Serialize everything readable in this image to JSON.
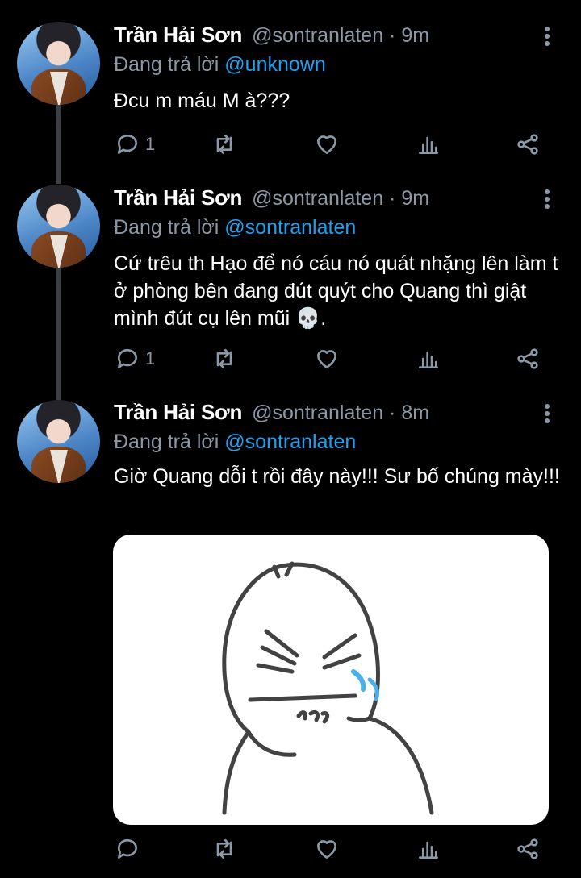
{
  "tweets": [
    {
      "name": "Trần Hải Sơn",
      "handle_time": "@sontranlaten · 9m",
      "reply_prefix": "Đang trả lời",
      "reply_to": "@unknown",
      "text": "Đcu m máu M à???",
      "reply_count": "1"
    },
    {
      "name": "Trần Hải Sơn",
      "handle_time": "@sontranlaten · 9m",
      "reply_prefix": "Đang trả lời",
      "reply_to": "@sontranlaten",
      "text": "Cứ trêu th Hạo để nó cáu nó quát nhặng lên làm t ở phòng bên đang đút quýt cho Quang thì giật mình đút cụ lên mũi 💀.",
      "reply_count": "1"
    },
    {
      "name": "Trần Hải Sơn",
      "handle_time": "@sontranlaten · 8m",
      "reply_prefix": "Đang trả lời",
      "reply_to": "@sontranlaten",
      "text": "Giờ Quang dỗi t rồi đây này!!! Sư bố chúng mày!!!",
      "reply_count": ""
    }
  ],
  "colors": {
    "background": "#000000",
    "secondary_text": "#8b98a5",
    "mention": "#1da1f2",
    "thread_line": "#3a3f44"
  },
  "icons": [
    "reply-icon",
    "retweet-icon",
    "like-icon",
    "analytics-icon",
    "share-icon",
    "more-options-icon"
  ]
}
